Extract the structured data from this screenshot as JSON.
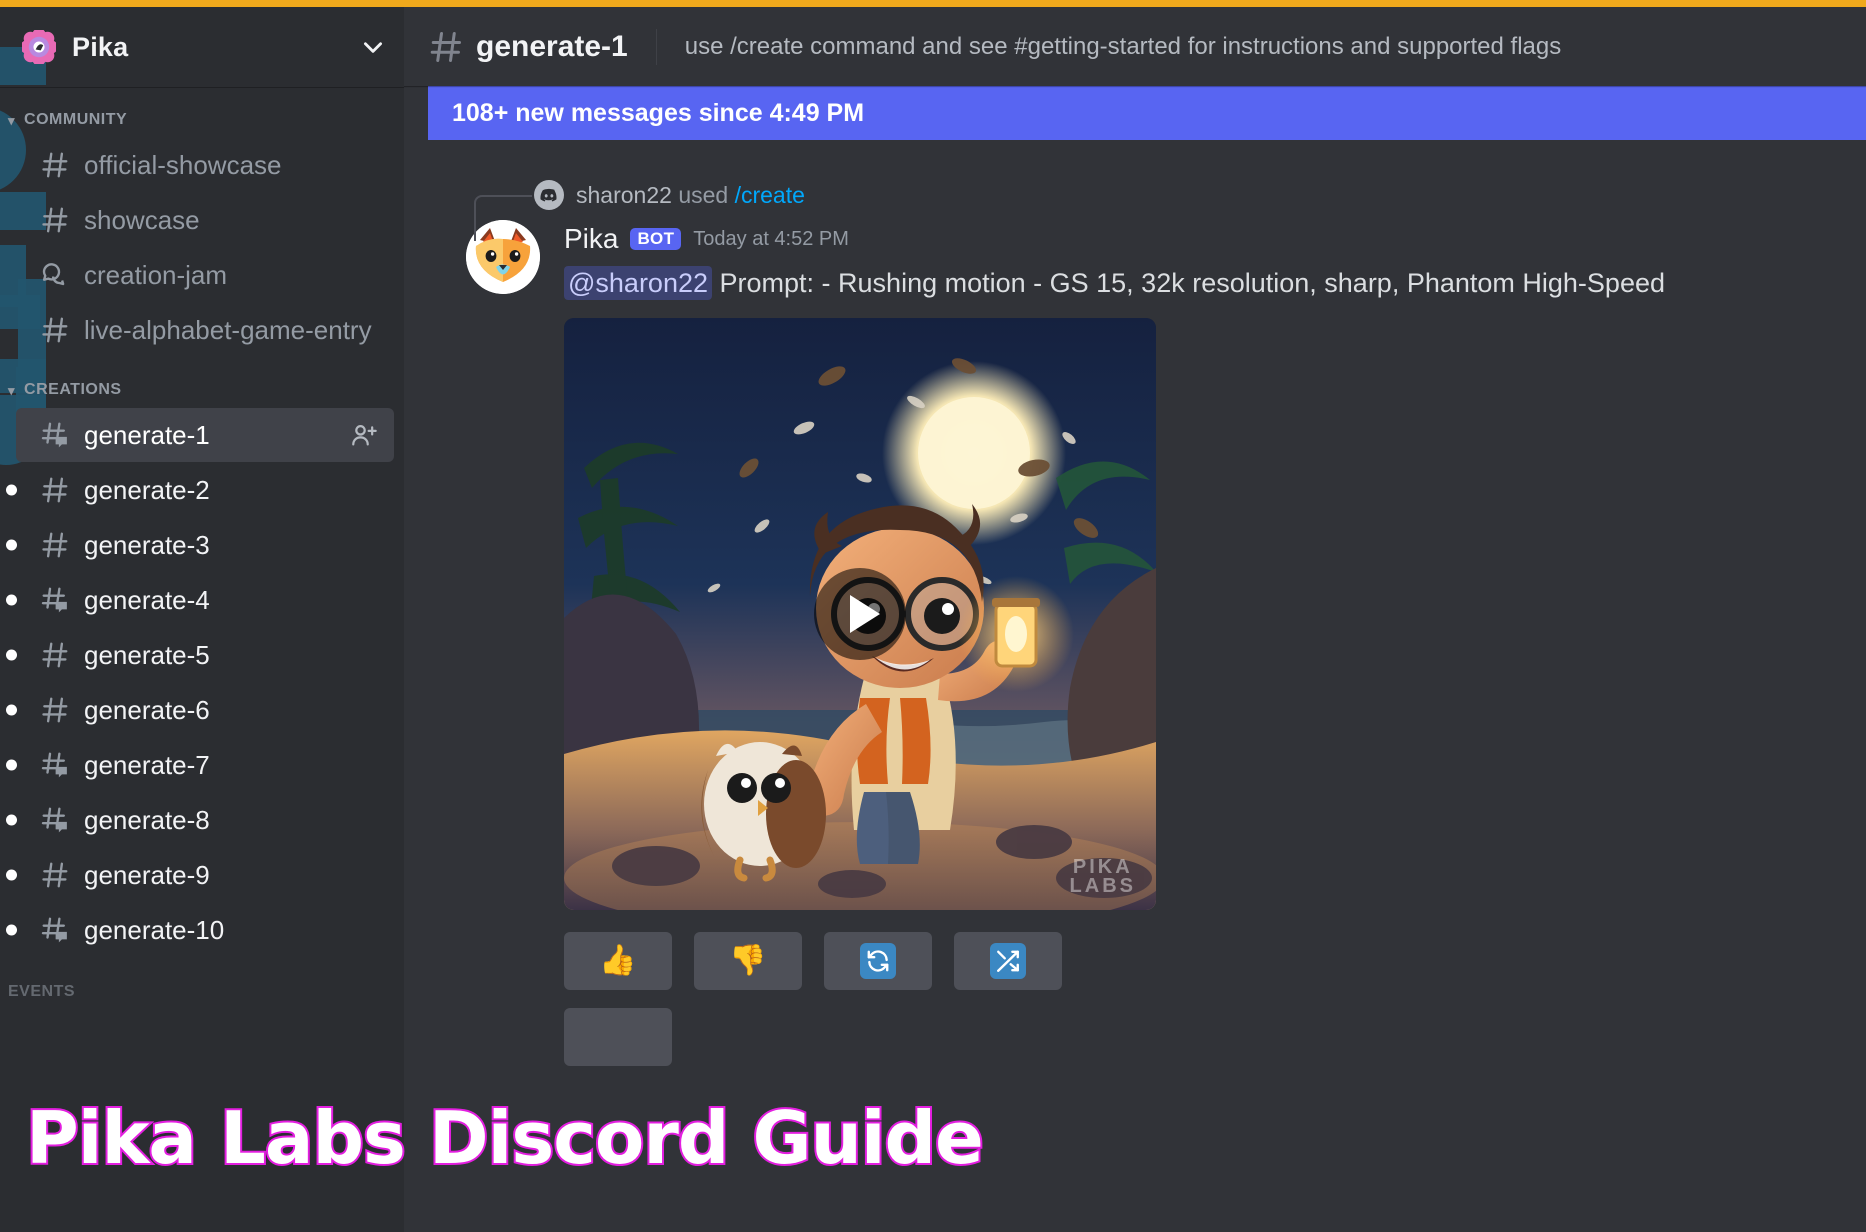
{
  "accent": {
    "top_bar_color": "#f0a91c",
    "brand_blurple": "#5865f2",
    "link_blue": "#00a8fc",
    "deco_teal": "#23566e"
  },
  "server": {
    "name": "Pika",
    "logo_icon": "pika-flower-logo",
    "dropdown_icon": "chevron-down-icon"
  },
  "sidebar": {
    "categories": [
      {
        "label": "COMMUNITY",
        "caret_icon": "caret-down-icon",
        "channels": [
          {
            "name": "official-showcase",
            "icon": "hash-icon",
            "unread": false,
            "active": false
          },
          {
            "name": "showcase",
            "icon": "hash-icon",
            "unread": false,
            "active": false
          },
          {
            "name": "creation-jam",
            "icon": "forum-icon",
            "unread": false,
            "active": false
          },
          {
            "name": "live-alphabet-game-entry",
            "icon": "hash-icon",
            "unread": false,
            "active": false
          }
        ]
      },
      {
        "label": "CREATIONS",
        "caret_icon": "caret-down-icon",
        "channels": [
          {
            "name": "generate-1",
            "icon": "hash-thread-icon",
            "unread": false,
            "active": true,
            "invite_icon": "add-member-icon"
          },
          {
            "name": "generate-2",
            "icon": "hash-icon",
            "unread": true,
            "active": false
          },
          {
            "name": "generate-3",
            "icon": "hash-icon",
            "unread": true,
            "active": false
          },
          {
            "name": "generate-4",
            "icon": "hash-thread-icon",
            "unread": true,
            "active": false
          },
          {
            "name": "generate-5",
            "icon": "hash-icon",
            "unread": true,
            "active": false
          },
          {
            "name": "generate-6",
            "icon": "hash-icon",
            "unread": true,
            "active": false
          },
          {
            "name": "generate-7",
            "icon": "hash-thread-icon",
            "unread": true,
            "active": false
          },
          {
            "name": "generate-8",
            "icon": "hash-thread-icon",
            "unread": true,
            "active": false
          },
          {
            "name": "generate-9",
            "icon": "hash-icon",
            "unread": true,
            "active": false
          },
          {
            "name": "generate-10",
            "icon": "hash-thread-icon",
            "unread": true,
            "active": false
          }
        ]
      }
    ],
    "footer_category": "EVENTS"
  },
  "channel_header": {
    "hash_icon": "hash-icon",
    "title": "generate-1",
    "topic": "use /create command and see #getting-started for instructions and supported flags"
  },
  "new_messages_bar": {
    "text": "108+ new messages since 4:49 PM"
  },
  "message": {
    "reply_context": {
      "discord_icon": "discord-logo-icon",
      "user": "sharon22",
      "action": "used",
      "command": "/create"
    },
    "avatar_icon": "pika-fox-avatar",
    "author": "Pika",
    "bot_badge": "BOT",
    "timestamp": "Today at 4:52 PM",
    "mention": "@sharon22",
    "prompt_text": "Prompt: - Rushing motion - GS 15, 32k resolution, sharp, Phantom High-Speed",
    "attachment": {
      "type": "video",
      "play_icon": "play-icon",
      "watermark_line1": "PIKA",
      "watermark_line2": "LABS"
    },
    "action_buttons": [
      {
        "label": "👍",
        "icon": "thumbs-up-icon",
        "name": "like-button"
      },
      {
        "label": "👎",
        "icon": "thumbs-down-icon",
        "name": "dislike-button"
      },
      {
        "label": "",
        "icon": "refresh-icon",
        "name": "regenerate-button"
      },
      {
        "label": "",
        "icon": "shuffle-icon",
        "name": "remix-button"
      }
    ]
  },
  "overlay": {
    "title": "Pika Labs Discord Guide",
    "fill_color": "#ffffff",
    "stroke_color": "#e31ee0"
  }
}
